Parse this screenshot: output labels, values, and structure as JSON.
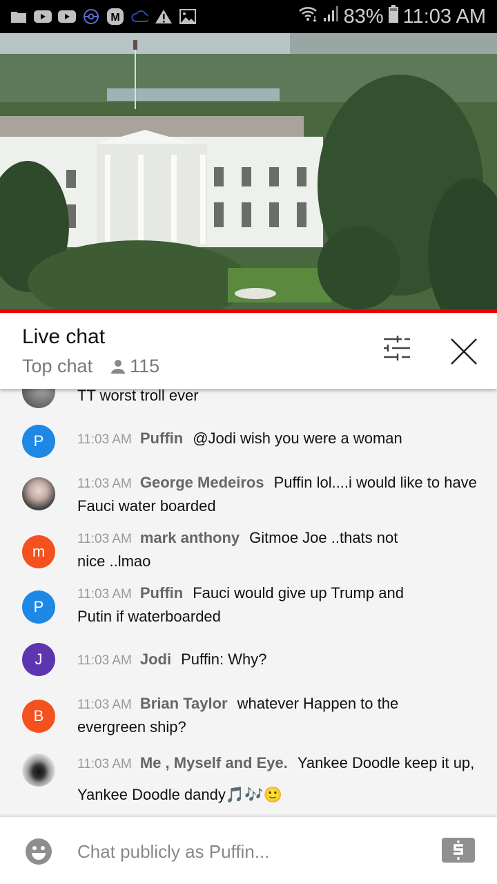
{
  "status_bar": {
    "notification_icons": [
      "folder-icon",
      "youtube-icon",
      "youtube-icon",
      "pokeball-icon",
      "m-app-icon",
      "cloud-icon",
      "warning-icon",
      "image-icon"
    ],
    "battery": "83%",
    "time": "11:03 AM"
  },
  "video": {
    "description": "Live stream of the White House north lawn",
    "progress_color": "#ee0000"
  },
  "chat_header": {
    "title": "Live chat",
    "mode": "Top chat",
    "viewer_count": "115"
  },
  "messages": [
    {
      "time": "",
      "author": "",
      "text": "TT worst troll ever",
      "avatar_color": "#666666",
      "avatar_letter": "",
      "avatar_type": "photo"
    },
    {
      "time": "11:03 AM",
      "author": "Puffin",
      "text": "@Jodi wish you were a woman",
      "avatar_color": "#1e88e5",
      "avatar_letter": "P",
      "avatar_type": "letter"
    },
    {
      "time": "11:03 AM",
      "author": "George Medeiros",
      "text": "Puffin lol....i would like to have Fauci water boarded",
      "avatar_color": "#c9b8b0",
      "avatar_letter": "",
      "avatar_type": "photo"
    },
    {
      "time": "11:03 AM",
      "author": "mark anthony",
      "text": "Gitmoe Joe ..thats not nice ..lmao",
      "avatar_color": "#f4511e",
      "avatar_letter": "m",
      "avatar_type": "letter"
    },
    {
      "time": "11:03 AM",
      "author": "Puffin",
      "text": "Fauci would give up Trump and Putin if waterboarded",
      "avatar_color": "#1e88e5",
      "avatar_letter": "P",
      "avatar_type": "letter"
    },
    {
      "time": "11:03 AM",
      "author": "Jodi",
      "text": "Puffin: Why?",
      "avatar_color": "#5e35b1",
      "avatar_letter": "J",
      "avatar_type": "letter"
    },
    {
      "time": "11:03 AM",
      "author": "Brian Taylor",
      "text": "whatever Happen to the evergreen ship?",
      "avatar_color": "#f4511e",
      "avatar_letter": "B",
      "avatar_type": "letter"
    },
    {
      "time": "11:03 AM",
      "author": "Me , Myself and Eye.",
      "text": "Yankee Doodle keep it up, Yankee Doodle dandy🎵🎶🙂",
      "avatar_color": "#dddddd",
      "avatar_letter": "",
      "avatar_type": "photo"
    }
  ],
  "composer": {
    "placeholder": "Chat publicly as Puffin..."
  }
}
